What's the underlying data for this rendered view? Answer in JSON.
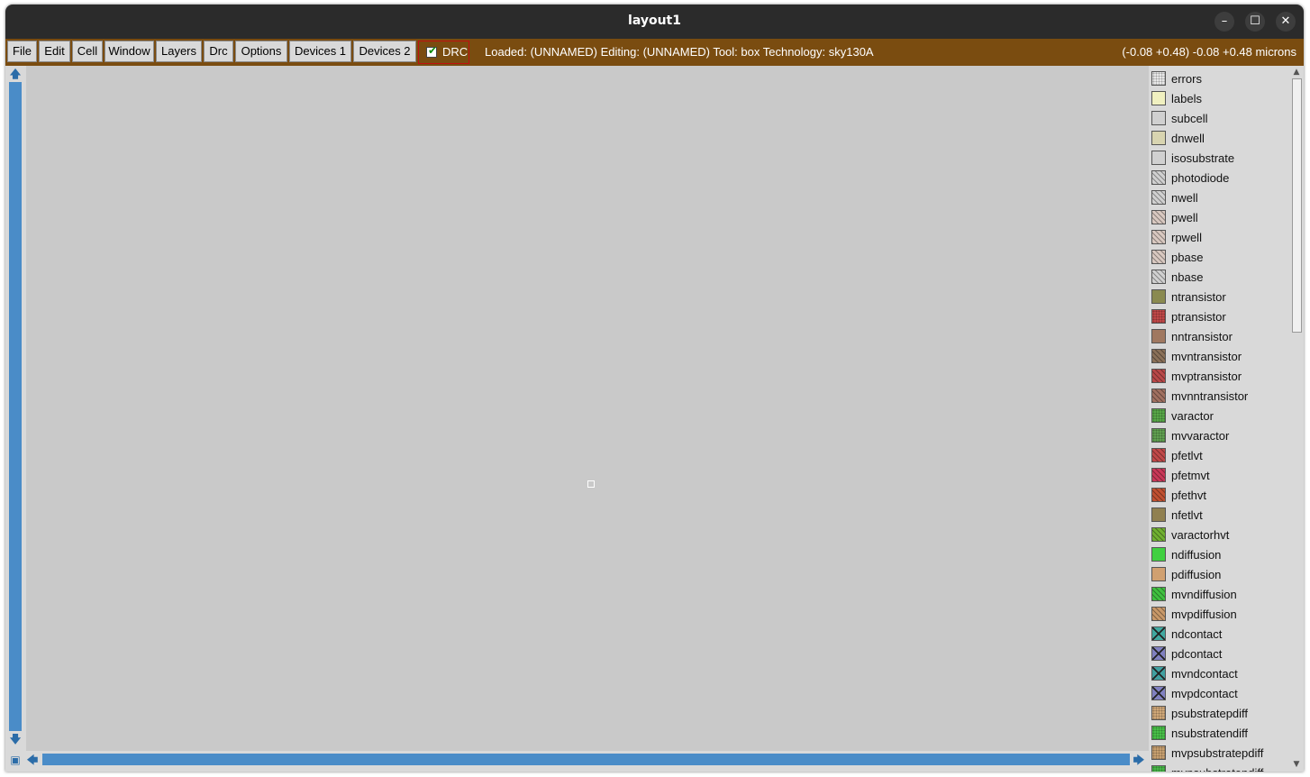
{
  "window": {
    "title": "layout1",
    "minimize_label": "–",
    "maximize_label": "☐",
    "close_label": "✕"
  },
  "menu": {
    "items": [
      "File",
      "Edit",
      "Cell",
      "Window",
      "Layers",
      "Drc",
      "Options",
      "Devices 1",
      "Devices 2"
    ],
    "drc_toggle": {
      "label": "DRC",
      "checked": true
    }
  },
  "status": {
    "text": "Loaded: (UNNAMED) Editing: (UNNAMED) Tool: box  Technology: sky130A",
    "coords": "(-0.08 +0.48) -0.08 +0.48 microns"
  },
  "colors": {
    "menubar_bg": "#7a4c10",
    "canvas_bg": "#c9c9c9",
    "scrollbar_track": "#4a8cc8"
  },
  "layers": [
    {
      "name": "errors",
      "swatch": "errors-dots-icon",
      "color": "#e8e8e8"
    },
    {
      "name": "labels",
      "swatch": "labels-icon",
      "color": "#f0f0c0"
    },
    {
      "name": "subcell",
      "swatch": "subcell-icon",
      "color": "#d0d0d0"
    },
    {
      "name": "dnwell",
      "swatch": "dnwell-icon",
      "color": "#d8d4b0"
    },
    {
      "name": "isosubstrate",
      "swatch": "isosubstrate-icon",
      "color": "#d0d0d0"
    },
    {
      "name": "photodiode",
      "swatch": "photodiode-hatch-icon",
      "color": "#d0d0d0"
    },
    {
      "name": "nwell",
      "swatch": "nwell-hatch-icon",
      "color": "#d0d0d0"
    },
    {
      "name": "pwell",
      "swatch": "pwell-hatch-icon",
      "color": "#d8c8c0"
    },
    {
      "name": "rpwell",
      "swatch": "rpwell-hatch-icon",
      "color": "#d8c8c0"
    },
    {
      "name": "pbase",
      "swatch": "pbase-hatch-icon",
      "color": "#d8c8c0"
    },
    {
      "name": "nbase",
      "swatch": "nbase-hatch-icon",
      "color": "#d0d0d0"
    },
    {
      "name": "ntransistor",
      "swatch": "ntransistor-icon",
      "color": "#8a8a50"
    },
    {
      "name": "ptransistor",
      "swatch": "ptransistor-icon",
      "color": "#c04848"
    },
    {
      "name": "nntransistor",
      "swatch": "nntransistor-icon",
      "color": "#a07860"
    },
    {
      "name": "mvntransistor",
      "swatch": "mvntransistor-icon",
      "color": "#8a7058"
    },
    {
      "name": "mvptransistor",
      "swatch": "mvptransistor-icon",
      "color": "#b84848"
    },
    {
      "name": "mvnntransistor",
      "swatch": "mvnntransistor-icon",
      "color": "#a07060"
    },
    {
      "name": "varactor",
      "swatch": "varactor-icon",
      "color": "#58a848"
    },
    {
      "name": "mvvaractor",
      "swatch": "mvvaractor-icon",
      "color": "#60a050"
    },
    {
      "name": "pfetlvt",
      "swatch": "pfetlvt-icon",
      "color": "#c04848"
    },
    {
      "name": "pfetmvt",
      "swatch": "pfetmvt-icon",
      "color": "#c83858"
    },
    {
      "name": "pfethvt",
      "swatch": "pfethvt-icon",
      "color": "#c05030"
    },
    {
      "name": "nfetlvt",
      "swatch": "nfetlvt-icon",
      "color": "#908050"
    },
    {
      "name": "varactorhvt",
      "swatch": "varactorhvt-icon",
      "color": "#70b030"
    },
    {
      "name": "ndiffusion",
      "swatch": "ndiffusion-icon",
      "color": "#40d040"
    },
    {
      "name": "pdiffusion",
      "swatch": "pdiffusion-icon",
      "color": "#d0a070"
    },
    {
      "name": "mvndiffusion",
      "swatch": "mvndiffusion-icon",
      "color": "#40c040"
    },
    {
      "name": "mvpdiffusion",
      "swatch": "mvpdiffusion-icon",
      "color": "#c89868"
    },
    {
      "name": "ndcontact",
      "swatch": "ndcontact-icon",
      "color": "#40a8a0"
    },
    {
      "name": "pdcontact",
      "swatch": "pdcontact-icon",
      "color": "#8080c0"
    },
    {
      "name": "mvndcontact",
      "swatch": "mvndcontact-icon",
      "color": "#40a0a0"
    },
    {
      "name": "mvpdcontact",
      "swatch": "mvpdcontact-icon",
      "color": "#8080c0"
    },
    {
      "name": "psubstratepdiff",
      "swatch": "psubstratepdiff-icon",
      "color": "#d0a878"
    },
    {
      "name": "nsubstratendiff",
      "swatch": "nsubstratendiff-icon",
      "color": "#48c048"
    },
    {
      "name": "mvpsubstratepdiff",
      "swatch": "mvpsubstratepdiff-icon",
      "color": "#c8a070"
    },
    {
      "name": "mvnsubstratendiff",
      "swatch": "mvnsubstratendiff-icon",
      "color": "#48b848"
    }
  ]
}
